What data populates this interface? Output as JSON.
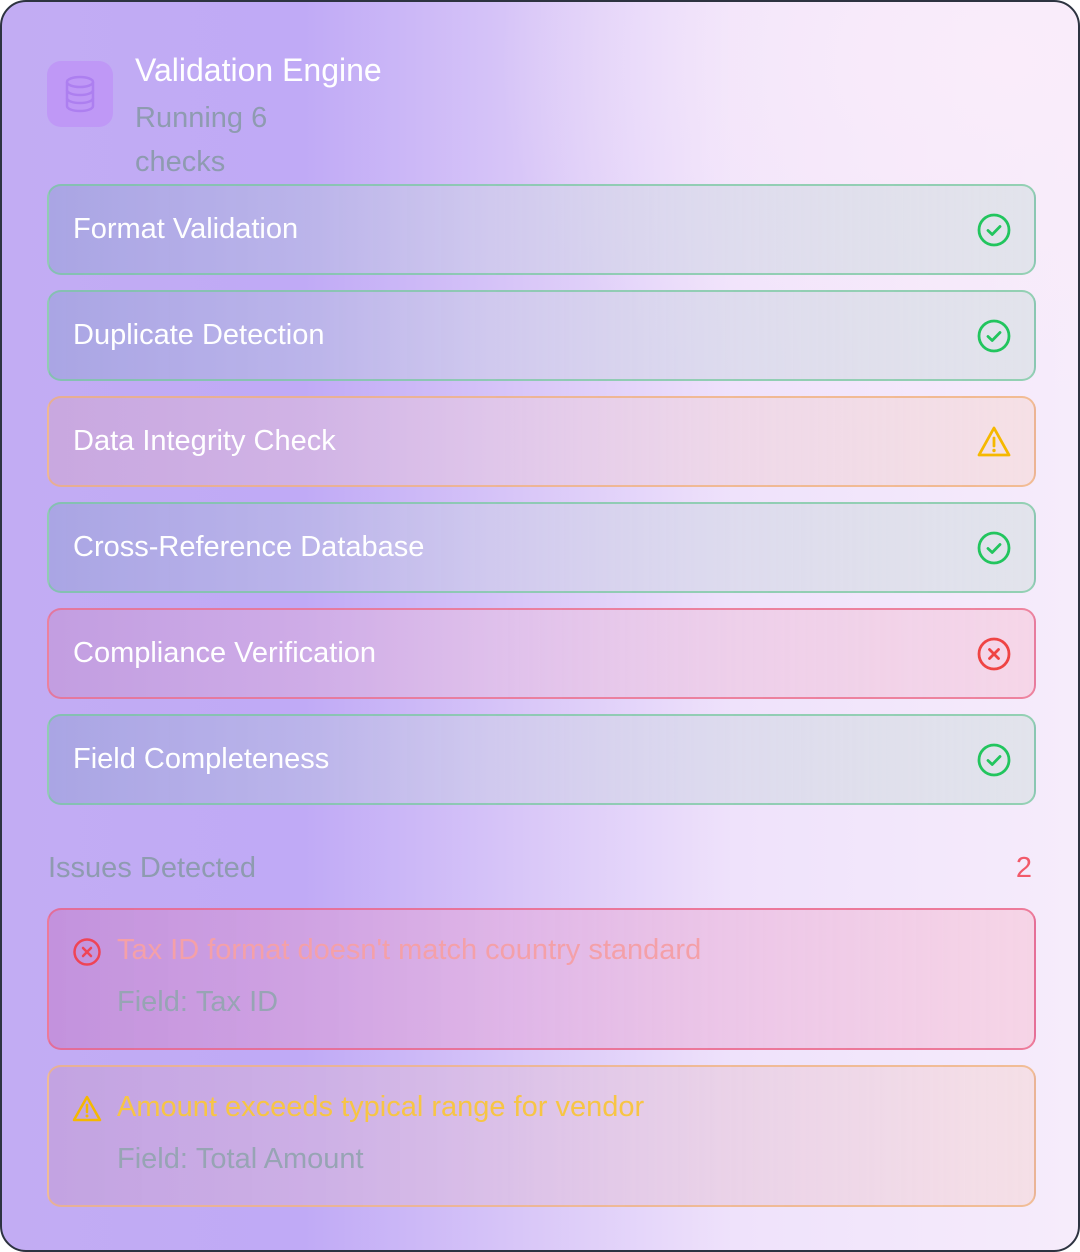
{
  "header": {
    "icon": "database-icon",
    "title": "Validation Engine",
    "subtitle": "Running 6 checks"
  },
  "checks": [
    {
      "label": "Format Validation",
      "status": "pass",
      "icon": "check-circle-icon"
    },
    {
      "label": "Duplicate Detection",
      "status": "pass",
      "icon": "check-circle-icon"
    },
    {
      "label": "Data Integrity Check",
      "status": "warning",
      "icon": "warning-triangle-icon"
    },
    {
      "label": "Cross-Reference Database",
      "status": "pass",
      "icon": "check-circle-icon"
    },
    {
      "label": "Compliance Verification",
      "status": "fail",
      "icon": "x-circle-icon"
    },
    {
      "label": "Field Completeness",
      "status": "pass",
      "icon": "check-circle-icon"
    }
  ],
  "issues": {
    "title": "Issues Detected",
    "count": "2",
    "field_prefix": "Field:",
    "items": [
      {
        "severity": "error",
        "icon": "x-circle-icon",
        "message": "Tax ID format doesn't match country standard",
        "field": "Tax ID"
      },
      {
        "severity": "warning",
        "icon": "warning-triangle-icon",
        "message": "Amount exceeds typical range for vendor",
        "field": "Total Amount"
      }
    ]
  },
  "colors": {
    "pass": "#22c55e",
    "warning": "#f5b800",
    "fail": "#ef4444",
    "accent": "#bf98f6"
  }
}
